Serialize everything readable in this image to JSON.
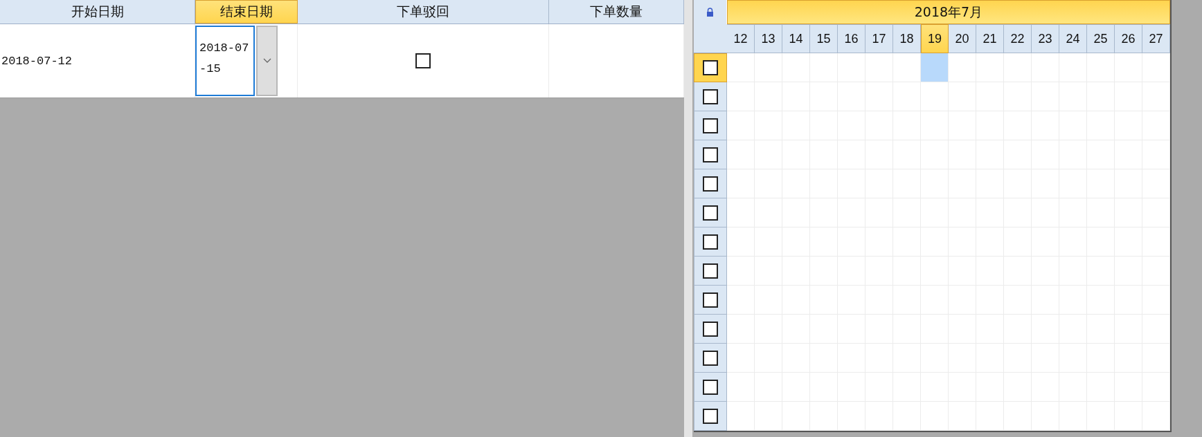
{
  "table": {
    "columns": [
      {
        "label": "开始日期",
        "selected": false
      },
      {
        "label": "结束日期",
        "selected": true
      },
      {
        "label": "下单驳回",
        "selected": false
      },
      {
        "label": "下单数量",
        "selected": false
      }
    ],
    "rows": [
      {
        "start_date": "2018-07-12",
        "end_date": "2018-07-15",
        "rejected": false
      }
    ]
  },
  "calendar": {
    "month": "2018年7月",
    "days": [
      {
        "label": "12",
        "selected": false
      },
      {
        "label": "13",
        "selected": false
      },
      {
        "label": "14",
        "selected": false
      },
      {
        "label": "15",
        "selected": false
      },
      {
        "label": "16",
        "selected": false
      },
      {
        "label": "17",
        "selected": false
      },
      {
        "label": "18",
        "selected": false
      },
      {
        "label": "19",
        "selected": true
      },
      {
        "label": "20",
        "selected": false
      },
      {
        "label": "21",
        "selected": false
      },
      {
        "label": "22",
        "selected": false
      },
      {
        "label": "23",
        "selected": false
      },
      {
        "label": "24",
        "selected": false
      },
      {
        "label": "25",
        "selected": false
      },
      {
        "label": "26",
        "selected": false
      },
      {
        "label": "27",
        "selected": false
      }
    ],
    "rows": [
      {
        "checked": false,
        "selected": true
      },
      {
        "checked": false,
        "selected": false
      },
      {
        "checked": false,
        "selected": false
      },
      {
        "checked": false,
        "selected": false
      },
      {
        "checked": false,
        "selected": false
      },
      {
        "checked": false,
        "selected": false
      },
      {
        "checked": false,
        "selected": false
      },
      {
        "checked": false,
        "selected": false
      },
      {
        "checked": false,
        "selected": false
      },
      {
        "checked": false,
        "selected": false
      },
      {
        "checked": false,
        "selected": false
      },
      {
        "checked": false,
        "selected": false
      },
      {
        "checked": false,
        "selected": false
      }
    ]
  }
}
